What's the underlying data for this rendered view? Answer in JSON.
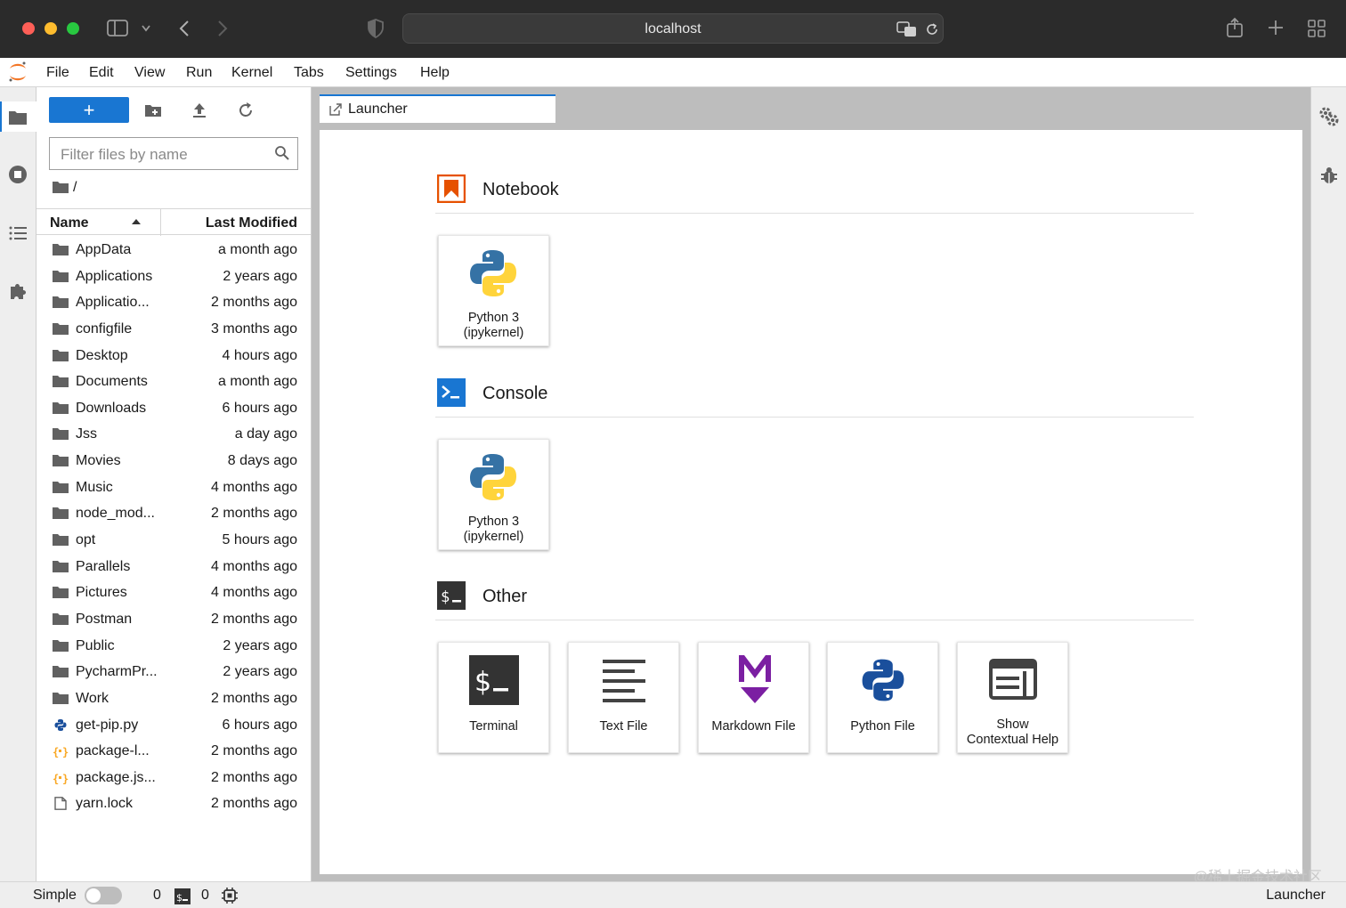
{
  "browser": {
    "url": "localhost"
  },
  "menu": [
    "File",
    "Edit",
    "View",
    "Run",
    "Kernel",
    "Tabs",
    "Settings",
    "Help"
  ],
  "filebrowser": {
    "new_label": "+",
    "filter_placeholder": "Filter files by name",
    "breadcrumb": "/",
    "col_name": "Name",
    "col_modified": "Last Modified",
    "items": [
      {
        "name": "AppData",
        "modified": "a month ago",
        "type": "folder"
      },
      {
        "name": "Applications",
        "modified": "2 years ago",
        "type": "folder"
      },
      {
        "name": "Applicatio...",
        "modified": "2 months ago",
        "type": "folder"
      },
      {
        "name": "configfile",
        "modified": "3 months ago",
        "type": "folder"
      },
      {
        "name": "Desktop",
        "modified": "4 hours ago",
        "type": "folder"
      },
      {
        "name": "Documents",
        "modified": "a month ago",
        "type": "folder"
      },
      {
        "name": "Downloads",
        "modified": "6 hours ago",
        "type": "folder"
      },
      {
        "name": "Jss",
        "modified": "a day ago",
        "type": "folder"
      },
      {
        "name": "Movies",
        "modified": "8 days ago",
        "type": "folder"
      },
      {
        "name": "Music",
        "modified": "4 months ago",
        "type": "folder"
      },
      {
        "name": "node_mod...",
        "modified": "2 months ago",
        "type": "folder"
      },
      {
        "name": "opt",
        "modified": "5 hours ago",
        "type": "folder"
      },
      {
        "name": "Parallels",
        "modified": "4 months ago",
        "type": "folder"
      },
      {
        "name": "Pictures",
        "modified": "4 months ago",
        "type": "folder"
      },
      {
        "name": "Postman",
        "modified": "2 months ago",
        "type": "folder"
      },
      {
        "name": "Public",
        "modified": "2 years ago",
        "type": "folder"
      },
      {
        "name": "PycharmPr...",
        "modified": "2 years ago",
        "type": "folder"
      },
      {
        "name": "Work",
        "modified": "2 months ago",
        "type": "folder"
      },
      {
        "name": "get-pip.py",
        "modified": "6 hours ago",
        "type": "python"
      },
      {
        "name": "package-l...",
        "modified": "2 months ago",
        "type": "json"
      },
      {
        "name": "package.js...",
        "modified": "2 months ago",
        "type": "json"
      },
      {
        "name": "yarn.lock",
        "modified": "2 months ago",
        "type": "file"
      }
    ]
  },
  "tab": {
    "label": "Launcher"
  },
  "launcher": {
    "notebook": {
      "title": "Notebook",
      "kernel_line1": "Python 3",
      "kernel_line2": "(ipykernel)"
    },
    "console": {
      "title": "Console",
      "kernel_line1": "Python 3",
      "kernel_line2": "(ipykernel)"
    },
    "other": {
      "title": "Other",
      "terminal": "Terminal",
      "text_file": "Text File",
      "markdown_file": "Markdown File",
      "python_file": "Python File",
      "help_line1": "Show",
      "help_line2": "Contextual Help"
    }
  },
  "statusbar": {
    "mode": "Simple",
    "kernels_count": "0",
    "terminals_count": "0",
    "current": "Launcher"
  },
  "watermark": "@稀土掘金技术社区",
  "colors": {
    "accent": "#1976d2",
    "notebook_icon": "#e65100",
    "console_icon": "#1976d2",
    "markdown": "#7b1fa2",
    "python_blue": "#3572a5",
    "python_yellow": "#ffd43b"
  }
}
